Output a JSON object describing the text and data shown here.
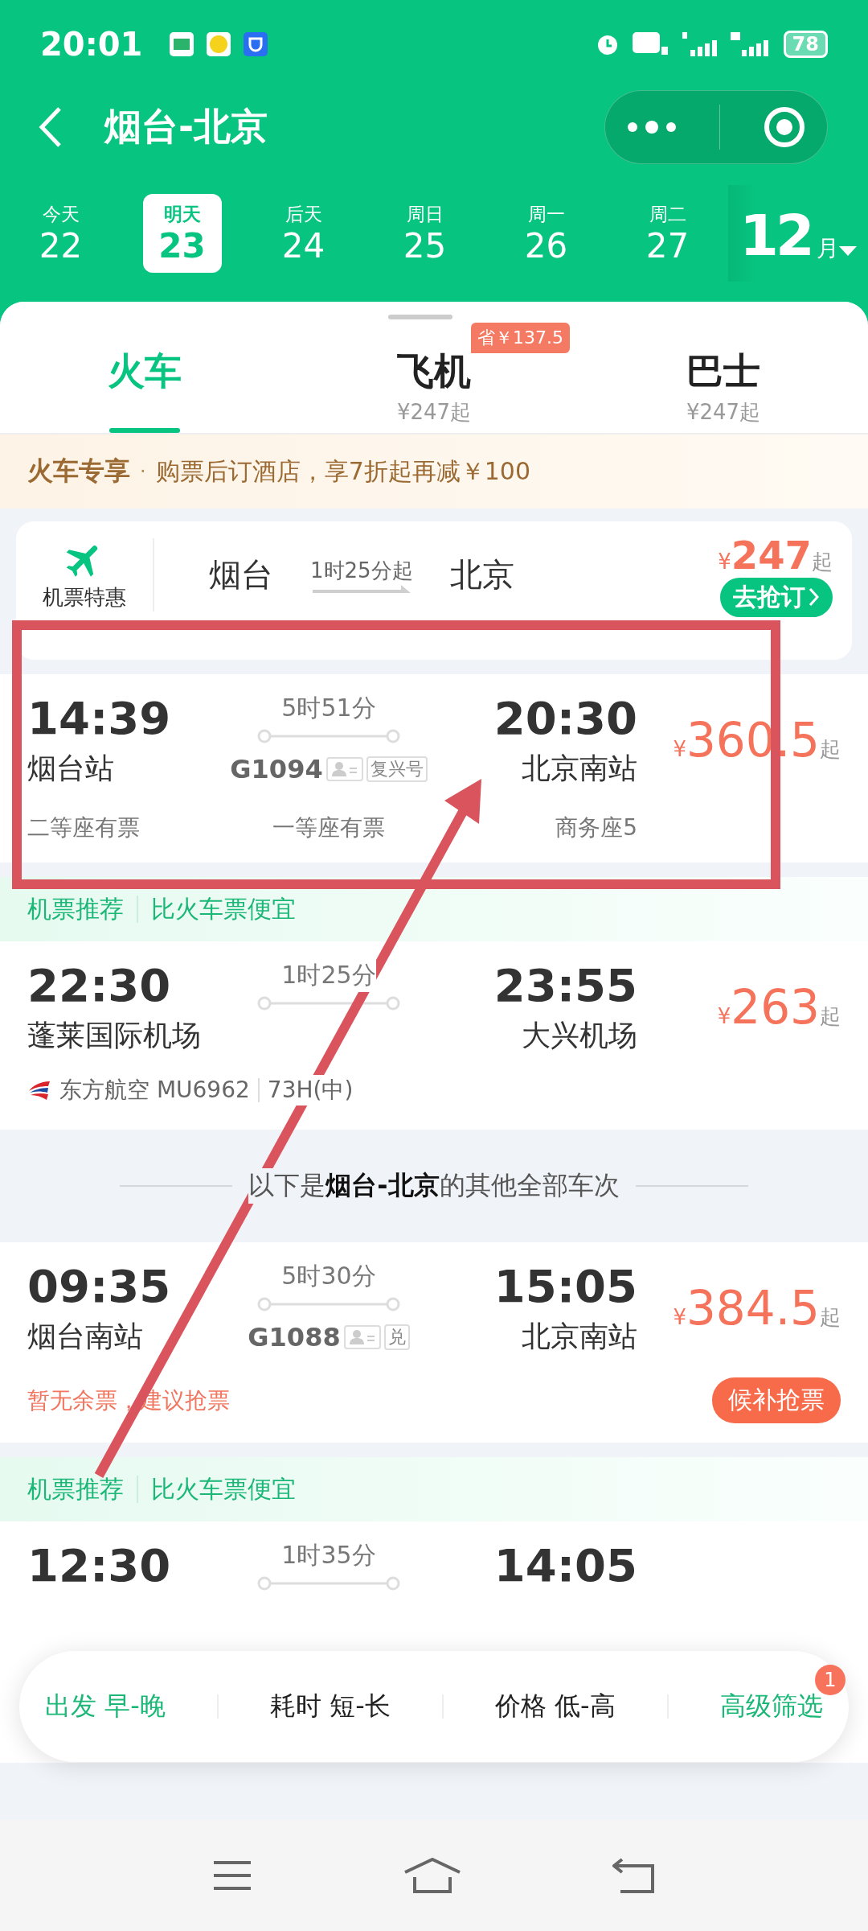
{
  "status_bar": {
    "time": "20:01",
    "battery": "78"
  },
  "header": {
    "title": "烟台-北京"
  },
  "dates": [
    {
      "label": "今天",
      "day": "22",
      "selected": false
    },
    {
      "label": "明天",
      "day": "23",
      "selected": true
    },
    {
      "label": "后天",
      "day": "24",
      "selected": false
    },
    {
      "label": "周日",
      "day": "25",
      "selected": false
    },
    {
      "label": "周一",
      "day": "26",
      "selected": false
    },
    {
      "label": "周二",
      "day": "27",
      "selected": false
    }
  ],
  "month": {
    "number": "12",
    "unit": "月"
  },
  "modes": [
    {
      "label": "火车",
      "selected": true
    },
    {
      "label": "飞机",
      "price": "¥247起",
      "badge": "省￥137.5",
      "selected": false
    },
    {
      "label": "巴士",
      "price": "¥247起",
      "selected": false
    }
  ],
  "promo": {
    "title": "火车专享",
    "separator": "·",
    "text": "购票后订酒店，享7折起再减￥100"
  },
  "flight_deal": {
    "label": "机票特惠",
    "from": "烟台",
    "duration": "1时25分起",
    "to": "北京",
    "currency": "¥",
    "price": "247",
    "suffix": "起",
    "button": "去抢订"
  },
  "results": [
    {
      "kind": "train",
      "depart": "14:39",
      "from": "烟台站",
      "duration": "5时51分",
      "number": "G1094",
      "tag": "复兴号",
      "arrive": "20:30",
      "to": "北京南站",
      "currency": "¥",
      "price": "360.5",
      "suffix": "起",
      "seats": [
        "二等座有票",
        "一等座有票",
        "商务座5"
      ]
    },
    {
      "kind": "flight",
      "tags": [
        "机票推荐",
        "比火车票便宜"
      ],
      "depart": "22:30",
      "from": "蓬莱国际机场",
      "duration": "1时25分",
      "arrive": "23:55",
      "to": "大兴机场",
      "currency": "¥",
      "price": "263",
      "suffix": "起",
      "airline": "东方航空",
      "flight_no": "MU6962",
      "aircraft": "73H(中)"
    },
    {
      "kind": "divider",
      "text": "以下是**烟台-北京**的其他全部车次"
    },
    {
      "kind": "train",
      "depart": "09:35",
      "from": "烟台南站",
      "duration": "5时30分",
      "number": "G1088",
      "tag": "兑",
      "arrive": "15:05",
      "to": "北京南站",
      "currency": "¥",
      "price": "384.5",
      "suffix": "起",
      "notice": "暂无余票，建议抢票",
      "action": "候补抢票"
    },
    {
      "kind": "flight",
      "tags": [
        "机票推荐",
        "比火车票便宜"
      ],
      "depart": "12:30",
      "duration": "1时35分",
      "arrive": "14:05"
    }
  ],
  "filters": {
    "sorts": [
      {
        "label": "出发 早-晚",
        "selected": true
      },
      {
        "label": "耗时 短-长",
        "selected": false
      },
      {
        "label": "价格 低-高",
        "selected": false
      }
    ],
    "advanced": {
      "label": "高级筛选",
      "badge": "1"
    }
  }
}
